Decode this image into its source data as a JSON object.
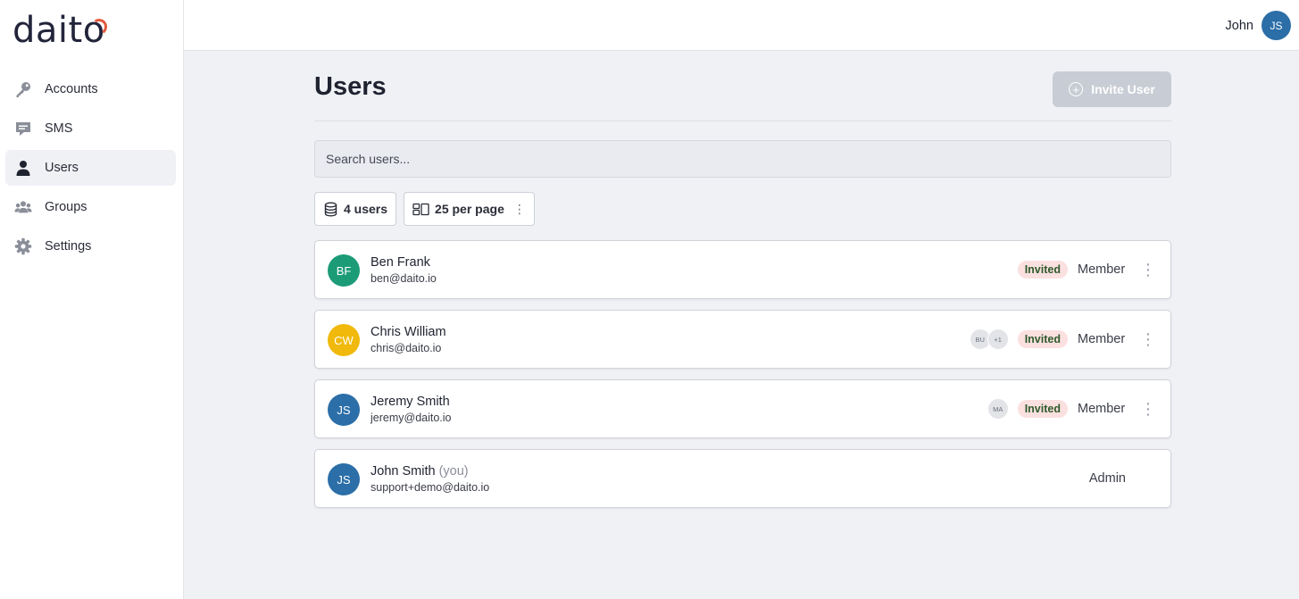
{
  "app": {
    "logo": "daito"
  },
  "sidebar": {
    "items": [
      {
        "label": "Accounts",
        "icon": "key-icon",
        "active": false
      },
      {
        "label": "SMS",
        "icon": "chat-icon",
        "active": false
      },
      {
        "label": "Users",
        "icon": "user-icon",
        "active": true
      },
      {
        "label": "Groups",
        "icon": "group-icon",
        "active": false
      },
      {
        "label": "Settings",
        "icon": "gear-icon",
        "active": false
      }
    ]
  },
  "topbar": {
    "user_name": "John",
    "user_initials": "JS"
  },
  "page": {
    "title": "Users",
    "invite_label": "Invite User",
    "search_placeholder": "Search users...",
    "count_label": "4 users",
    "per_page_label": "25 per page"
  },
  "colors": {
    "accent": "#2b6ea8",
    "logo_accent": "#e45a3c",
    "invited_bg": "#fbe0e0",
    "disabled_button": "#c8ccd4"
  },
  "users": [
    {
      "initials": "BF",
      "name": "Ben Frank",
      "suffix": "",
      "email": "ben@daito.io",
      "groups": [],
      "status": "Invited",
      "role": "Member",
      "avatar_color": "#1c9b77",
      "menu": true
    },
    {
      "initials": "CW",
      "name": "Chris William",
      "suffix": "",
      "email": "chris@daito.io",
      "groups": [
        "BU",
        "+1"
      ],
      "status": "Invited",
      "role": "Member",
      "avatar_color": "#f0b90b",
      "menu": true
    },
    {
      "initials": "JS",
      "name": "Jeremy Smith",
      "suffix": "",
      "email": "jeremy@daito.io",
      "groups": [
        "MA"
      ],
      "status": "Invited",
      "role": "Member",
      "avatar_color": "#2b6ea8",
      "menu": true
    },
    {
      "initials": "JS",
      "name": "John Smith",
      "suffix": "(you)",
      "email": "support+demo@daito.io",
      "groups": [],
      "status": "",
      "role": "Admin",
      "avatar_color": "#2b6ea8",
      "menu": false
    }
  ]
}
